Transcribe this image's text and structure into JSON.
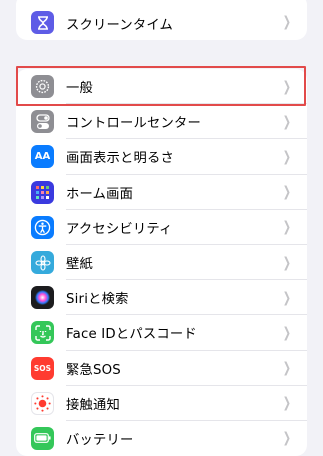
{
  "top_group": {
    "items": [
      {
        "label": "スクリーンタイム",
        "icon": "hourglass-icon",
        "color": "#5e5ce6"
      }
    ]
  },
  "main_group": {
    "items": [
      {
        "label": "一般",
        "icon": "gear-icon",
        "color": "#8e8e93"
      },
      {
        "label": "コントロールセンター",
        "icon": "toggles-icon",
        "color": "#8e8e93"
      },
      {
        "label": "画面表示と明るさ",
        "icon": "text-size-icon",
        "color": "#0a7cff"
      },
      {
        "label": "ホーム画面",
        "icon": "home-grid-icon",
        "color": "#3a3adf"
      },
      {
        "label": "アクセシビリティ",
        "icon": "accessibility-icon",
        "color": "#0a7cff"
      },
      {
        "label": "壁紙",
        "icon": "flower-icon",
        "color": "#35aadc"
      },
      {
        "label": "Siriと検索",
        "icon": "siri-icon",
        "color": "#222222"
      },
      {
        "label": "Face IDとパスコード",
        "icon": "face-id-icon",
        "color": "#34c759"
      },
      {
        "label": "緊急SOS",
        "icon": "sos-icon",
        "color": "#ff3b30"
      },
      {
        "label": "接触通知",
        "icon": "exposure-notification-icon",
        "color": "#ffffff"
      },
      {
        "label": "バッテリー",
        "icon": "battery-icon",
        "color": "#34c759"
      }
    ]
  },
  "icon_text": {
    "sos": "SOS",
    "aa": "AA"
  },
  "highlight_color": "#e24a4a"
}
